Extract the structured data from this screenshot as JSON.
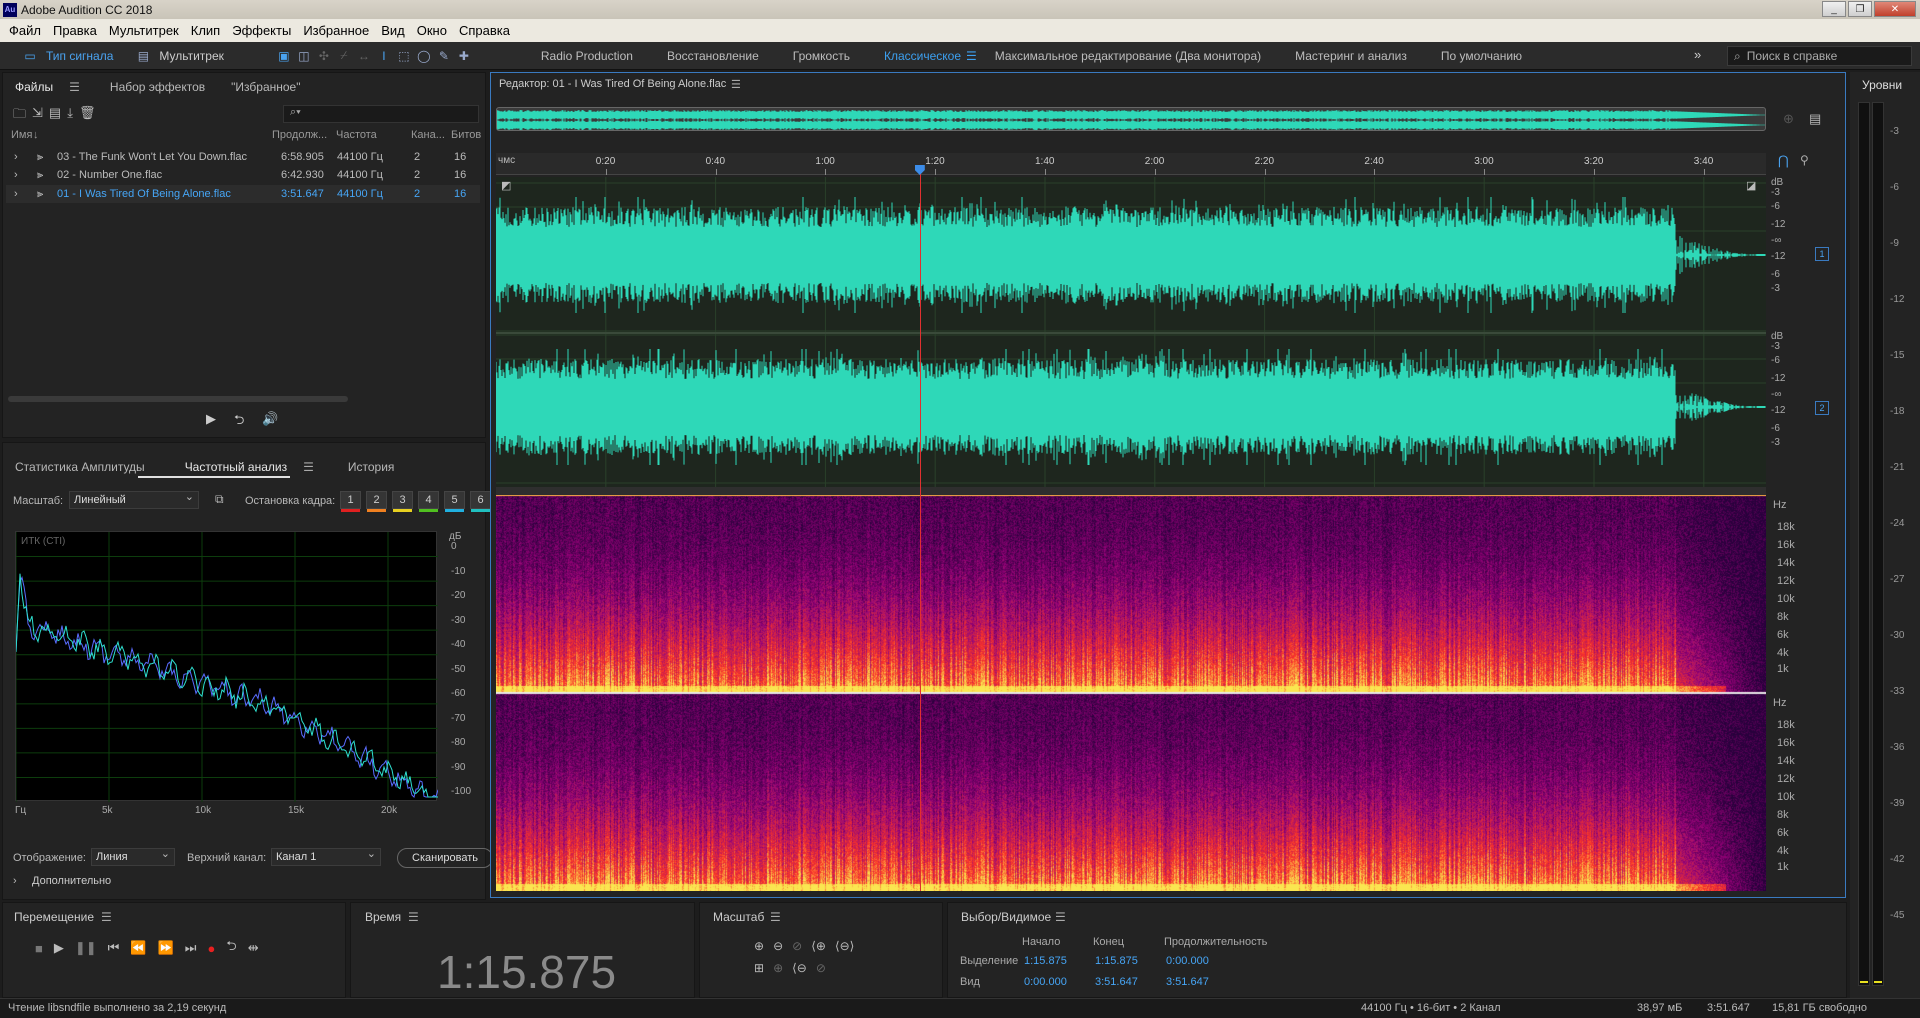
{
  "title": "Adobe Audition CC 2018",
  "app_icon": "Au",
  "menu": [
    "Файл",
    "Правка",
    "Мультитрек",
    "Клип",
    "Эффекты",
    "Избранное",
    "Вид",
    "Окно",
    "Справка"
  ],
  "toolbar": {
    "mode_waveform": "Тип сигнала",
    "mode_multitrack": "Мультитрек",
    "workspaces": [
      "Radio Production",
      "Восстановление",
      "Громкость",
      "Классическое",
      "Максимальное редактирование (Два монитора)",
      "Мастеринг и анализ",
      "По умолчанию"
    ],
    "active_workspace": "Классическое",
    "search_placeholder": "Поиск в справке"
  },
  "files_panel": {
    "tabs": [
      "Файлы",
      "Набор эффектов",
      "\"Избранное\""
    ],
    "columns": [
      "Имя",
      "Продолж...",
      "Частота",
      "Кана...",
      "Битов"
    ],
    "files": [
      {
        "name": "03 - The Funk Won't Let You Down.flac",
        "duration": "6:58.905",
        "rate": "44100 Гц",
        "channels": "2",
        "bits": "16"
      },
      {
        "name": "02 - Number One.flac",
        "duration": "6:42.930",
        "rate": "44100 Гц",
        "channels": "2",
        "bits": "16"
      },
      {
        "name": "01 - I Was Tired Of Being Alone.flac",
        "duration": "3:51.647",
        "rate": "44100 Гц",
        "channels": "2",
        "bits": "16"
      }
    ],
    "selected_index": 2
  },
  "analysis_panel": {
    "tabs": [
      "Статистика Амплитуды",
      "Частотный анализ",
      "История"
    ],
    "scale_label": "Масштаб:",
    "scale_value": "Линейный",
    "freeze_label": "Остановка кадра:",
    "freeze_slots": [
      "1",
      "2",
      "3",
      "4",
      "5",
      "6"
    ],
    "freeze_colors": [
      "#e02020",
      "#f08020",
      "#e8d020",
      "#50c020",
      "#20b0e0",
      "#20c0c0"
    ],
    "plot_label": "ИТК (СТI)",
    "db_unit": "дБ",
    "db_ticks": [
      "0",
      "-10",
      "-20",
      "-30",
      "-40",
      "-50",
      "-60",
      "-70",
      "-80",
      "-90",
      "-100"
    ],
    "freq_ticks": [
      "Гц",
      "5k",
      "10k",
      "15k",
      "20k"
    ],
    "display_label": "Отображение:",
    "display_value": "Линия",
    "top_channel_label": "Верхний канал:",
    "top_channel_value": "Канал 1",
    "scan_button": "Сканировать",
    "advanced_label": "Дополнительно"
  },
  "editor": {
    "title": "Редактор: 01 - I Was Tired Of Being Alone.flac",
    "time_unit": "чмс",
    "time_ticks": [
      "0:20",
      "0:40",
      "1:00",
      "1:20",
      "1:40",
      "2:00",
      "2:20",
      "2:40",
      "3:00",
      "3:20",
      "3:40"
    ],
    "db_labels_ch1": [
      "dB",
      "-3",
      "-6",
      "-12",
      "-∞",
      "-12",
      "-6",
      "-3"
    ],
    "db_labels_ch2": [
      "dB",
      "-3",
      "-6",
      "-12",
      "-∞",
      "-12",
      "-6",
      "-3"
    ],
    "channel_badges": [
      "1",
      "2"
    ],
    "hz_labels": [
      "Hz",
      "18k",
      "16k",
      "14k",
      "12k",
      "10k",
      "8k",
      "6k",
      "4k",
      "1k"
    ],
    "playhead_time_fraction": 0.3337,
    "waveform_color": "#2ed8b8"
  },
  "levels_panel": {
    "title": "Уровни",
    "ticks": [
      "-3",
      "-6",
      "-9",
      "-12",
      "-15",
      "-18",
      "-21",
      "-24",
      "-27",
      "-30",
      "-33",
      "-36",
      "-39",
      "-42",
      "-45"
    ]
  },
  "transport": {
    "title": "Перемещение"
  },
  "time_panel": {
    "title": "Время",
    "current": "1:15.875"
  },
  "zoom_panel": {
    "title": "Масштаб"
  },
  "selection_panel": {
    "title": "Выбор/Видимое",
    "col_start": "Начало",
    "col_end": "Конец",
    "col_duration": "Продолжительность",
    "row_selection": "Выделение",
    "row_view": "Вид",
    "sel_start": "1:15.875",
    "sel_end": "1:15.875",
    "sel_duration": "0:00.000",
    "view_start": "0:00.000",
    "view_end": "3:51.647",
    "view_duration": "3:51.647"
  },
  "statusbar": {
    "message": "Чтение libsndfile выполнено за 2,19 секунд",
    "format": "44100 Гц • 16-бит • 2 Канал",
    "size": "38,97 мБ",
    "duration": "3:51.647",
    "free": "15,81 ГБ свободно"
  }
}
